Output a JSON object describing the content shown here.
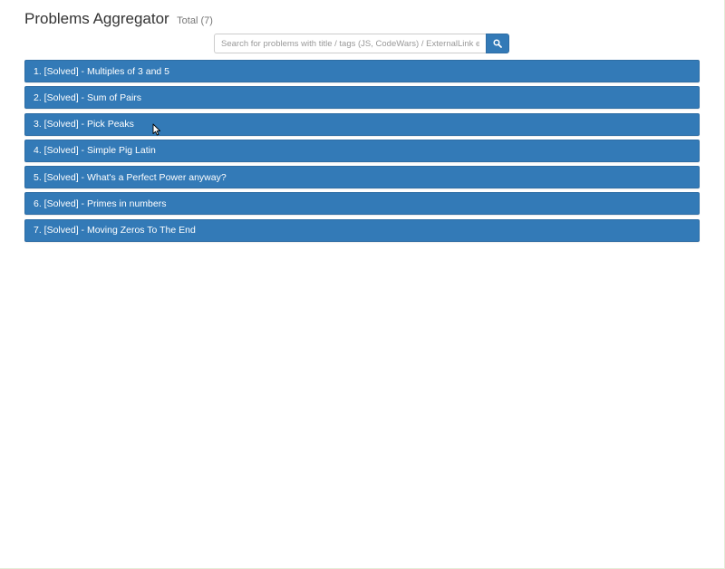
{
  "header": {
    "title": "Problems Aggregator",
    "total": "Total (7)"
  },
  "search": {
    "placeholder": "Search for problems with title / tags (JS, CodeWars) / ExternalLink etc",
    "icon": "search-icon"
  },
  "problems": [
    {
      "label": "1. [Solved] - Multiples of 3 and 5"
    },
    {
      "label": "2. [Solved] - Sum of Pairs"
    },
    {
      "label": "3. [Solved] - Pick Peaks"
    },
    {
      "label": "4. [Solved] - Simple Pig Latin"
    },
    {
      "label": "5. [Solved] - What's a Perfect Power anyway?"
    },
    {
      "label": "6. [Solved] - Primes in numbers"
    },
    {
      "label": "7. [Solved] - Moving Zeros To The End"
    }
  ],
  "colors": {
    "accent": "#337ab7",
    "accent_border": "#2e6da4"
  }
}
